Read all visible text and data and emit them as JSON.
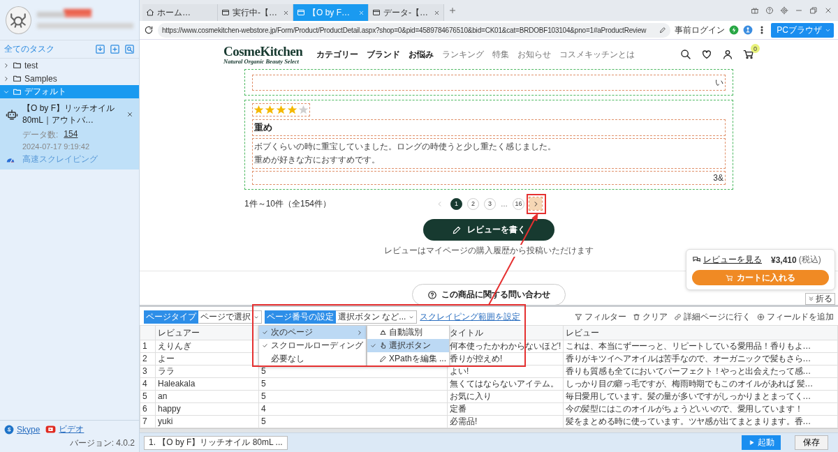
{
  "sidebar": {
    "all_tasks": "全てのタスク",
    "tree": [
      {
        "kind": "folder",
        "label": "test",
        "expanded": false,
        "selected": false
      },
      {
        "kind": "folder",
        "label": "Samples",
        "expanded": false,
        "selected": false
      },
      {
        "kind": "folder",
        "label": "デフォルト",
        "expanded": true,
        "selected": true,
        "children": [
          {
            "kind": "task",
            "title": "【O by F】リッチオイル 80mL｜アウトバ…",
            "count_label": "データ数:",
            "count": "154",
            "date": "2024-07-17 9:19:42",
            "mode": "高速スクレイピング"
          }
        ]
      }
    ],
    "links": [
      {
        "kind": "skype",
        "label": "Skype"
      },
      {
        "kind": "video",
        "label": "ビデオ"
      }
    ],
    "version": "バージョン: 4.0.2"
  },
  "browser": {
    "tabs": [
      {
        "kind": "home",
        "label": "ホーム…",
        "selected": false
      },
      {
        "kind": "page",
        "label": "実行中-【…",
        "selected": false
      },
      {
        "kind": "page",
        "label": "【O by F…",
        "selected": true
      },
      {
        "kind": "page",
        "label": "データ-【…",
        "selected": false
      }
    ],
    "url": "https://www.cosmekitchen-webstore.jp/Form/Product/ProductDetail.aspx?shop=0&pid=4589784676510&bid=CK01&cat=BRDOBF103104&pno=1#aProductReview",
    "pre_login": "事前ログイン",
    "mode_button": "PCブラウザ"
  },
  "page": {
    "logo": "CosmeKitchen",
    "tagline": "Natural Organic Beauty Select",
    "nav": [
      {
        "label": "カテゴリー",
        "bold": true
      },
      {
        "label": "ブランド",
        "bold": true
      },
      {
        "label": "お悩み",
        "bold": true
      },
      {
        "label": "ランキング",
        "bold": false
      },
      {
        "label": "特集",
        "bold": false
      },
      {
        "label": "お知らせ",
        "bold": false
      },
      {
        "label": "コスメキッチンとは",
        "bold": false
      }
    ],
    "cart_count": "0",
    "previous_review_tail": "い",
    "review": {
      "stars": 4,
      "title": "重め",
      "body_lines": [
        "ボブくらいの時に重宝していました。ロングの時使うと少し重たく感じました。",
        "重めが好きな方におすすめです。"
      ],
      "footer": "3&"
    },
    "range": "1件～10件（全154件）",
    "prev_disabled": true,
    "next_highlighted": true,
    "pages": [
      {
        "kind": "page",
        "label": "1",
        "selected": true
      },
      {
        "kind": "page",
        "label": "2",
        "selected": false
      },
      {
        "kind": "page",
        "label": "3",
        "selected": false
      },
      {
        "kind": "gap",
        "label": "…"
      },
      {
        "kind": "page",
        "label": "16",
        "selected": false
      }
    ],
    "write_button": "レビューを書く",
    "write_note": "レビューはマイページの購入履歴から投稿いただけます",
    "inquiry_button": "この商品に関する問い合わせ",
    "float": {
      "link": "レビューを見る",
      "price": "¥3,410",
      "tax": "(税込)",
      "cart_button": "カートに入れる"
    },
    "fold_button": "折る"
  },
  "extractor": {
    "page_type_label": "ページタイプ",
    "page_type": "ページで選択",
    "paging_label": "ページ番号の設定",
    "paging": "選択ボタン など...",
    "range_link": "スクレイピング範囲を設定",
    "tools": [
      {
        "kind": "filter",
        "label": "フィルター"
      },
      {
        "kind": "clear",
        "label": "クリア"
      },
      {
        "kind": "detail",
        "label": "詳細ページに行く"
      },
      {
        "kind": "add",
        "label": "フィールドを追加"
      }
    ],
    "columns": [
      {
        "label": "レビュアー"
      },
      {},
      {
        "label": "タイトル"
      },
      {
        "label": "レビュー"
      }
    ],
    "rows": [
      {
        "index": "1",
        "cells": [
          "えりんぎ",
          null,
          "何本使ったかわからないほど!",
          "これは、本当にずーーっと、リピートしている愛用品！香りもよ…"
        ]
      },
      {
        "index": "2",
        "cells": [
          "よー",
          null,
          "香りが控えめ!",
          "香りがキツイヘアオイルは苦手なので、オーガニックで髪もさら…"
        ]
      },
      {
        "index": "3",
        "cells": [
          "ララ",
          "5",
          "よい!",
          "香りも質感も全てにおいてパーフェクト！やっと出会えたって感…"
        ]
      },
      {
        "index": "4",
        "cells": [
          "Haleakala",
          "5",
          "無くてはならないアイテム。",
          "しっかり目の癖っ毛ですが、梅雨時期でもこのオイルがあれば 髪…"
        ]
      },
      {
        "index": "5",
        "cells": [
          "an",
          "5",
          "お気に入り",
          "毎日愛用しています。髪の量が多いですがしっかりまとまってく…"
        ]
      },
      {
        "index": "6",
        "cells": [
          "happy",
          "4",
          "定番",
          "今の髪型にはこのオイルがちょうどいいので、愛用しています！"
        ]
      },
      {
        "index": "7",
        "cells": [
          "yuki",
          "5",
          "必需品!",
          "髪をまとめる時に使っています。ツヤ感が出てまとまります。香…"
        ]
      }
    ],
    "menu": [
      {
        "label": "次のページ",
        "checked": true,
        "selected": true,
        "submenu": true
      },
      {
        "label": "スクロールローディング",
        "checked": true,
        "selected": false,
        "submenu": false
      },
      {
        "label": "必要なし",
        "checked": false,
        "selected": false,
        "submenu": false
      }
    ],
    "submenu": [
      {
        "kind": "auto",
        "label": "自動識別",
        "checked": false,
        "selected": false
      },
      {
        "kind": "pointer",
        "label": "選択ボタン",
        "checked": true,
        "selected": true
      },
      {
        "kind": "edit",
        "label": "XPathを編集 ...",
        "checked": false,
        "selected": false
      }
    ]
  },
  "footer": {
    "tab": "1. 【O by F】リッチオイル 80mL ...",
    "start_button": "起動",
    "save_button": "保存"
  }
}
